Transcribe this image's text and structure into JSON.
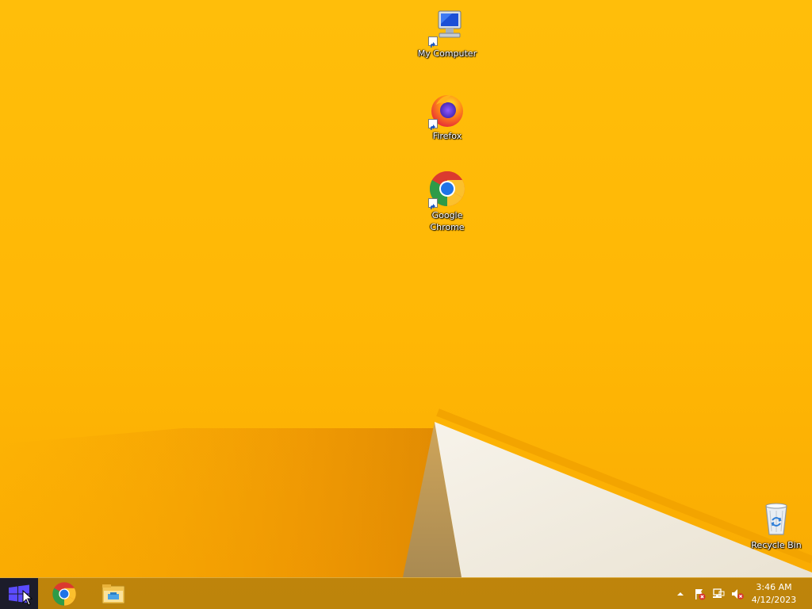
{
  "desktop": {
    "icons": [
      {
        "label": "My Computer",
        "icon": "my-computer-icon"
      },
      {
        "label": "Firefox",
        "icon": "firefox-icon"
      },
      {
        "label": "Google\nChrome",
        "icon": "chrome-icon"
      },
      {
        "label": "Recycle Bin",
        "icon": "recycle-bin-icon"
      }
    ],
    "wallpaper_colors": {
      "background": "#ffb705",
      "paper": "#f2ede0",
      "shadow": "#e08d04"
    }
  },
  "taskbar": {
    "start_icon": "windows-logo-icon",
    "pinned": [
      {
        "icon": "chrome-icon"
      },
      {
        "icon": "file-explorer-icon"
      }
    ],
    "tray": {
      "icons": [
        "show-hidden-icons-chevron",
        "action-center-flag-icon",
        "network-icon",
        "volume-muted-icon"
      ]
    },
    "clock": {
      "time": "3:46 AM",
      "date": "4/12/2023"
    }
  }
}
